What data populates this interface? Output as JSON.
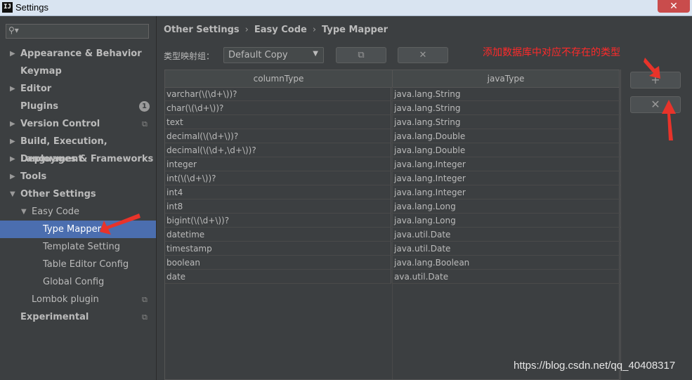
{
  "window": {
    "title": "Settings",
    "app_icon": "IJ",
    "close_glyph": "✕"
  },
  "sidebar": {
    "items": [
      {
        "label": "Appearance & Behavior",
        "arrow": "▶",
        "bold": true
      },
      {
        "label": "Keymap",
        "arrow": "",
        "bold": true
      },
      {
        "label": "Editor",
        "arrow": "▶",
        "bold": true
      },
      {
        "label": "Plugins",
        "arrow": "",
        "bold": true,
        "badge": "1"
      },
      {
        "label": "Version Control",
        "arrow": "▶",
        "bold": true,
        "copy": true
      },
      {
        "label": "Build, Execution, Deployment",
        "arrow": "▶",
        "bold": true
      },
      {
        "label": "Languages & Frameworks",
        "arrow": "▶",
        "bold": true
      },
      {
        "label": "Tools",
        "arrow": "▶",
        "bold": true
      },
      {
        "label": "Other Settings",
        "arrow": "▼",
        "bold": true
      },
      {
        "label": "Easy Code",
        "arrow": "▼",
        "bold": false
      },
      {
        "label": "Type Mapper",
        "arrow": "",
        "bold": false,
        "selected": true
      },
      {
        "label": "Template Setting",
        "arrow": "",
        "bold": false
      },
      {
        "label": "Table Editor Config",
        "arrow": "",
        "bold": false
      },
      {
        "label": "Global Config",
        "arrow": "",
        "bold": false
      },
      {
        "label": "Lombok plugin",
        "arrow": "",
        "bold": false,
        "copy": true
      },
      {
        "label": "Experimental",
        "arrow": "",
        "bold": true,
        "copy": true
      }
    ]
  },
  "breadcrumb": {
    "items": [
      "Other Settings",
      "Easy Code",
      "Type Mapper"
    ],
    "separator": "›"
  },
  "toolbar": {
    "group_label": "类型映射组：",
    "group_value": "Default Copy",
    "copy_glyph": "⧉",
    "delete_glyph": "✕"
  },
  "table": {
    "headers": [
      "columnType",
      "javaType"
    ],
    "rows": [
      [
        "varchar(\\(\\d+\\))?",
        "java.lang.String"
      ],
      [
        "char(\\(\\d+\\))?",
        "java.lang.String"
      ],
      [
        "text",
        "java.lang.String"
      ],
      [
        "decimal(\\(\\d+\\))?",
        "java.lang.Double"
      ],
      [
        "decimal(\\(\\d+,\\d+\\))?",
        "java.lang.Double"
      ],
      [
        "integer",
        "java.lang.Integer"
      ],
      [
        "int(\\(\\d+\\))?",
        "java.lang.Integer"
      ],
      [
        "int4",
        "java.lang.Integer"
      ],
      [
        "int8",
        "java.lang.Long"
      ],
      [
        "bigint(\\(\\d+\\))?",
        "java.lang.Long"
      ],
      [
        "datetime",
        "java.util.Date"
      ],
      [
        "timestamp",
        "java.util.Date"
      ],
      [
        "boolean",
        "java.lang.Boolean"
      ],
      [
        "date",
        "ava.util.Date"
      ]
    ]
  },
  "side_buttons": {
    "add_glyph": "+",
    "remove_glyph": "✕"
  },
  "annotation": {
    "text": "添加数据库中对应不存在的类型",
    "color": "#ff2a2a"
  },
  "watermark": {
    "text": "https://blog.csdn.net/qq_40408317"
  },
  "colors": {
    "selection": "#4b6eaf",
    "background": "#3c3f41",
    "arrow": "#e8332a"
  }
}
